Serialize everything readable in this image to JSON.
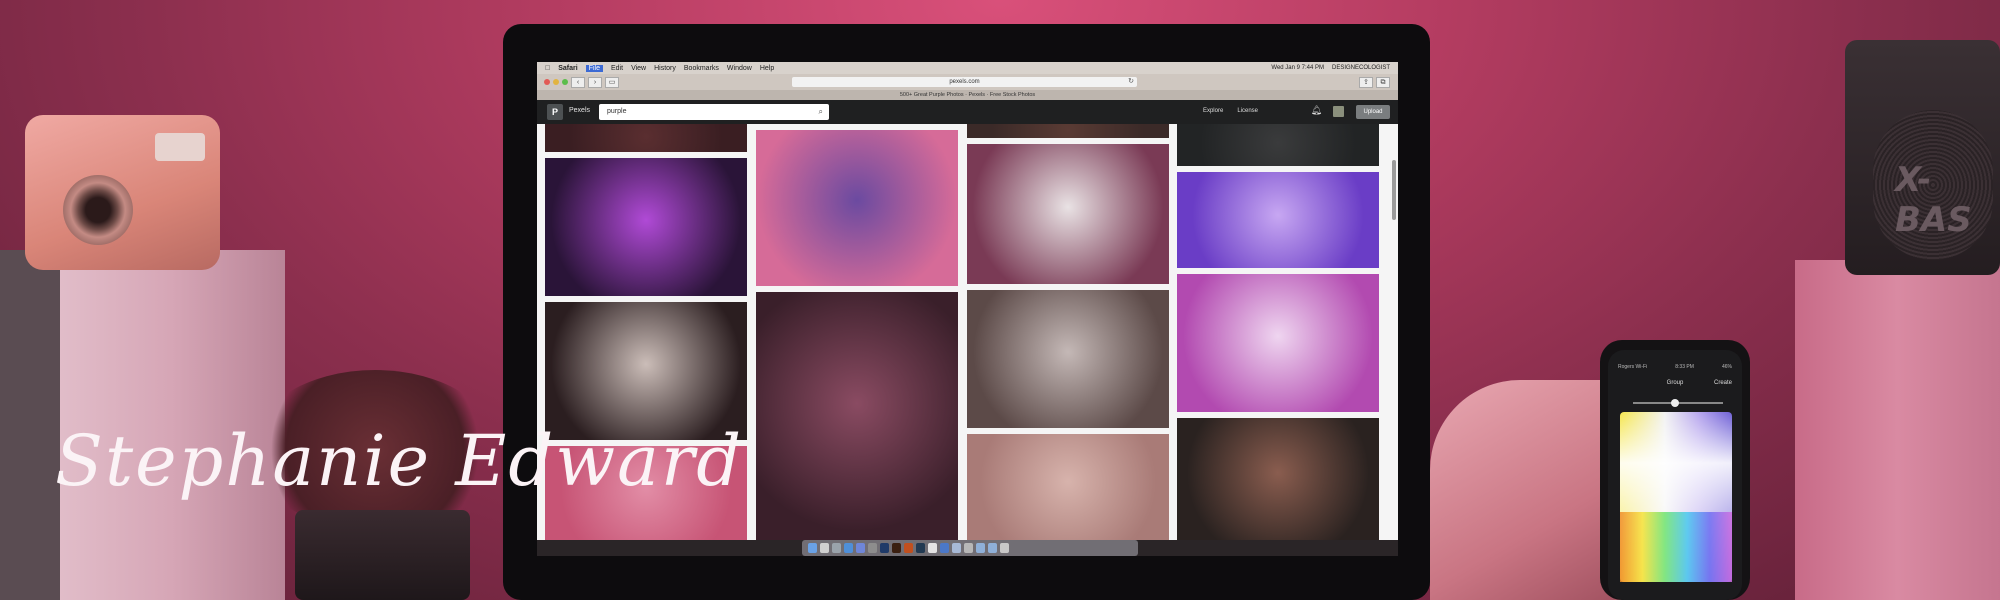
{
  "signature": "Stephanie Edward",
  "speaker_brand": "X-BAS",
  "menubar": {
    "apple": "",
    "items": [
      "Safari",
      "File",
      "Edit",
      "View",
      "History",
      "Bookmarks",
      "Window",
      "Help"
    ],
    "right": [
      "Wed Jan 9  7:44 PM",
      "DESIGNECOLOGIST"
    ]
  },
  "browser": {
    "url": "pexels.com",
    "tab_title": "500+ Great Purple Photos · Pexels · Free Stock Photos"
  },
  "site": {
    "logo": "P",
    "brand": "Pexels",
    "search_value": "purple",
    "nav": [
      "Explore",
      "License"
    ],
    "upload_label": "Upload"
  },
  "phone": {
    "carrier": "Rogers Wi-Fi",
    "time": "8:33 PM",
    "battery": "46%",
    "title": "Group",
    "action": "Create"
  },
  "photos": [
    {
      "name": "dark-strip-photo",
      "colors": [
        "#3a1e22",
        "#5a2e30"
      ]
    },
    {
      "name": "fiber-optic-lamp-photo",
      "colors": [
        "#2a1438",
        "#b04ad6"
      ]
    },
    {
      "name": "white-daisy-photo",
      "colors": [
        "#2b1e20",
        "#cbbdb8"
      ]
    },
    {
      "name": "pink-wall-photo",
      "colors": [
        "#c75475",
        "#e28da6"
      ]
    },
    {
      "name": "pink-hydrangea-photo",
      "colors": [
        "#d66b98",
        "#6b4aa0"
      ]
    },
    {
      "name": "purple-flowers-photo",
      "colors": [
        "#3a1f2a",
        "#8a4b62"
      ]
    },
    {
      "name": "dark-strip-photo-2",
      "colors": [
        "#3b2a28",
        "#5a3b34"
      ]
    },
    {
      "name": "balloons-photo",
      "colors": [
        "#7a3a55",
        "#e9e2e4"
      ]
    },
    {
      "name": "dandelion-field-photo",
      "colors": [
        "#5c4a48",
        "#c4b8b6"
      ]
    },
    {
      "name": "wooden-house-photo",
      "colors": [
        "#a97b77",
        "#d7b3ac"
      ]
    },
    {
      "name": "dark-strip-photo-3",
      "colors": [
        "#222425",
        "#3a3b3c"
      ]
    },
    {
      "name": "water-drop-photo",
      "colors": [
        "#6a3dc6",
        "#c7a7f2"
      ]
    },
    {
      "name": "birds-sunset-photo",
      "colors": [
        "#b24ab0",
        "#efd5f0"
      ]
    },
    {
      "name": "dried-flower-photo",
      "colors": [
        "#2a2220",
        "#8a5d4f"
      ]
    }
  ]
}
